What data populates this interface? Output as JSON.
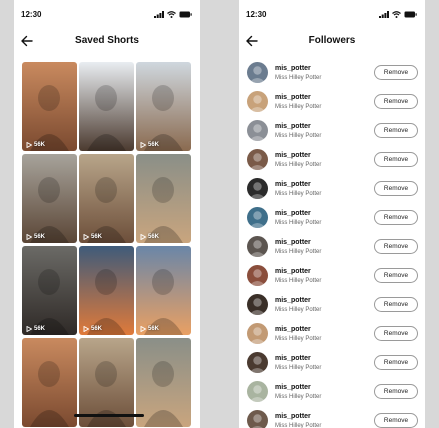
{
  "status": {
    "time": "12:30"
  },
  "saved_shorts": {
    "title": "Saved Shorts",
    "tiles": [
      {
        "views": "56K",
        "palette": [
          "#c98a5f",
          "#7b4a30"
        ],
        "show_views": true
      },
      {
        "views": "",
        "palette": [
          "#e9edf1",
          "#4b3a2f"
        ],
        "show_views": false
      },
      {
        "views": "56K",
        "palette": [
          "#cfd7de",
          "#8a6a4f"
        ],
        "show_views": true
      },
      {
        "views": "56K",
        "palette": [
          "#a7a39b",
          "#5b4636"
        ],
        "show_views": true
      },
      {
        "views": "56K",
        "palette": [
          "#b8a58a",
          "#6d4f3a"
        ],
        "show_views": true
      },
      {
        "views": "56K",
        "palette": [
          "#8a8f88",
          "#c9a57e"
        ],
        "show_views": true
      },
      {
        "views": "56K",
        "palette": [
          "#6b6a66",
          "#2f2a27"
        ],
        "show_views": true
      },
      {
        "views": "56K",
        "palette": [
          "#3f5b7a",
          "#e07a3a"
        ],
        "show_views": true
      },
      {
        "views": "56K",
        "palette": [
          "#6a86a8",
          "#e9a063"
        ],
        "show_views": true
      },
      {
        "views": "",
        "palette": [
          "#c98a5f",
          "#7b4a30"
        ],
        "show_views": false
      },
      {
        "views": "",
        "palette": [
          "#b8a58a",
          "#6d4f3a"
        ],
        "show_views": false
      },
      {
        "views": "",
        "palette": [
          "#8a8f88",
          "#c9a57e"
        ],
        "show_views": false
      }
    ]
  },
  "followers": {
    "title": "Followers",
    "remove_label": "Remove",
    "items": [
      {
        "username": "mis_potter",
        "name": "Miss Hilley Potter",
        "avatar_color": "#6b7c8f"
      },
      {
        "username": "mis_potter",
        "name": "Miss Hilley Potter",
        "avatar_color": "#c8a27a"
      },
      {
        "username": "mis_potter",
        "name": "Miss Hilley Potter",
        "avatar_color": "#8b8f96"
      },
      {
        "username": "mis_potter",
        "name": "Miss Hilley Potter",
        "avatar_color": "#7a5a48"
      },
      {
        "username": "mis_potter",
        "name": "Miss Hilley Potter",
        "avatar_color": "#2b2b2b"
      },
      {
        "username": "mis_potter",
        "name": "Miss Hilley Potter",
        "avatar_color": "#3f6f8a"
      },
      {
        "username": "mis_potter",
        "name": "Miss Hilley Potter",
        "avatar_color": "#5c5550"
      },
      {
        "username": "mis_potter",
        "name": "Miss Hilley Potter",
        "avatar_color": "#8a4e3c"
      },
      {
        "username": "mis_potter",
        "name": "Miss Hilley Potter",
        "avatar_color": "#3a2f28"
      },
      {
        "username": "mis_potter",
        "name": "Miss Hilley Potter",
        "avatar_color": "#c29a74"
      },
      {
        "username": "mis_potter",
        "name": "Miss Hilley Potter",
        "avatar_color": "#4a3a30"
      },
      {
        "username": "mis_potter",
        "name": "Miss Hilley Potter",
        "avatar_color": "#a9b4a0"
      },
      {
        "username": "mis_potter",
        "name": "Miss Hilley Potter",
        "avatar_color": "#6e5a4c"
      }
    ]
  }
}
